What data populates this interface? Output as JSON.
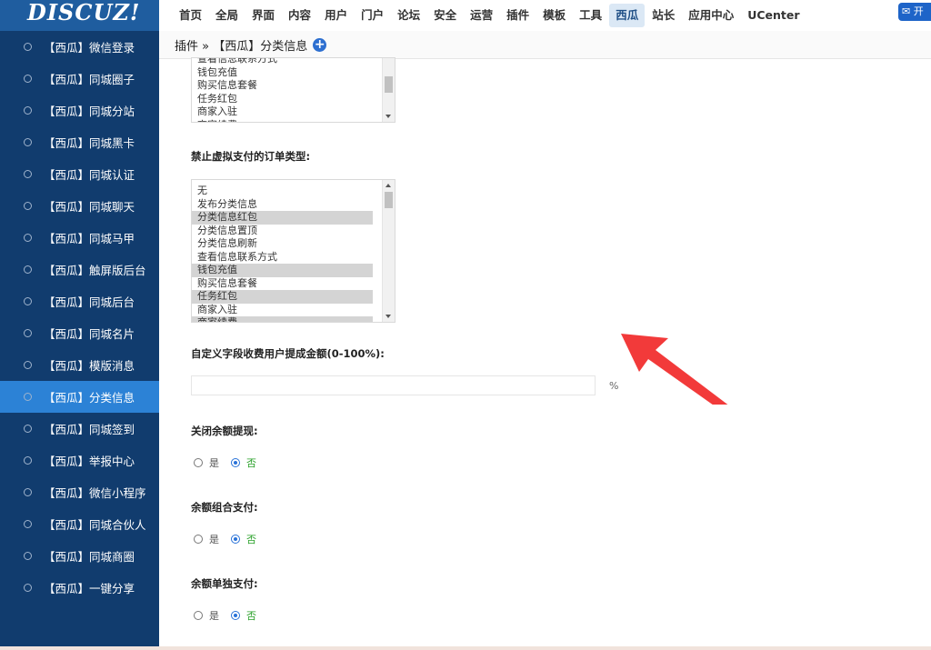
{
  "brand": {
    "logo_text": "DISCUZ!"
  },
  "topnav": {
    "items": [
      "首页",
      "全局",
      "界面",
      "内容",
      "用户",
      "门户",
      "论坛",
      "安全",
      "运营",
      "插件",
      "模板",
      "工具",
      "西瓜",
      "站长",
      "应用中心",
      "UCenter"
    ],
    "active_index": 12,
    "open_button": "开"
  },
  "sidebar": {
    "items": [
      "【西瓜】微信登录",
      "【西瓜】同城圈子",
      "【西瓜】同城分站",
      "【西瓜】同城黑卡",
      "【西瓜】同城认证",
      "【西瓜】同城聊天",
      "【西瓜】同城马甲",
      "【西瓜】触屏版后台",
      "【西瓜】同城后台",
      "【西瓜】同城名片",
      "【西瓜】模版消息",
      "【西瓜】分类信息",
      "【西瓜】同城签到",
      "【西瓜】举报中心",
      "【西瓜】微信小程序",
      "【西瓜】同城合伙人",
      "【西瓜】同城商圈",
      "【西瓜】一键分享"
    ],
    "active_index": 11
  },
  "breadcrumb": {
    "path": "插件 » 【西瓜】分类信息"
  },
  "top_list": {
    "options": [
      "查看信息联系方式",
      "钱包充值",
      "购买信息套餐",
      "任务红包",
      "商家入驻",
      "商家续费"
    ]
  },
  "forbid_virtual_pay": {
    "label": "禁止虚拟支付的订单类型:",
    "options": [
      {
        "text": "无",
        "selected": false
      },
      {
        "text": "发布分类信息",
        "selected": false
      },
      {
        "text": "分类信息红包",
        "selected": true
      },
      {
        "text": "分类信息置顶",
        "selected": false
      },
      {
        "text": "分类信息刷新",
        "selected": false
      },
      {
        "text": "查看信息联系方式",
        "selected": false
      },
      {
        "text": "钱包充值",
        "selected": true
      },
      {
        "text": "购买信息套餐",
        "selected": false
      },
      {
        "text": "任务红包",
        "selected": true
      },
      {
        "text": "商家入驻",
        "selected": false
      },
      {
        "text": "商家续费",
        "selected": true
      }
    ]
  },
  "custom_fee": {
    "label": "自定义字段收费用户提成金额(0-100%):",
    "value": "",
    "unit": "%"
  },
  "close_withdraw": {
    "label": "关闭余额提现:",
    "yes": "是",
    "no": "否",
    "value": "no"
  },
  "combo_pay": {
    "label": "余额组合支付:",
    "yes": "是",
    "no": "否",
    "value": "no"
  },
  "solo_pay": {
    "label": "余额单独支付:",
    "yes": "是",
    "no": "否",
    "value": "no"
  },
  "colors": {
    "sidebar_bg": "#113c6e",
    "sidebar_active": "#2c82d6",
    "arrow": "#f23a3a"
  }
}
